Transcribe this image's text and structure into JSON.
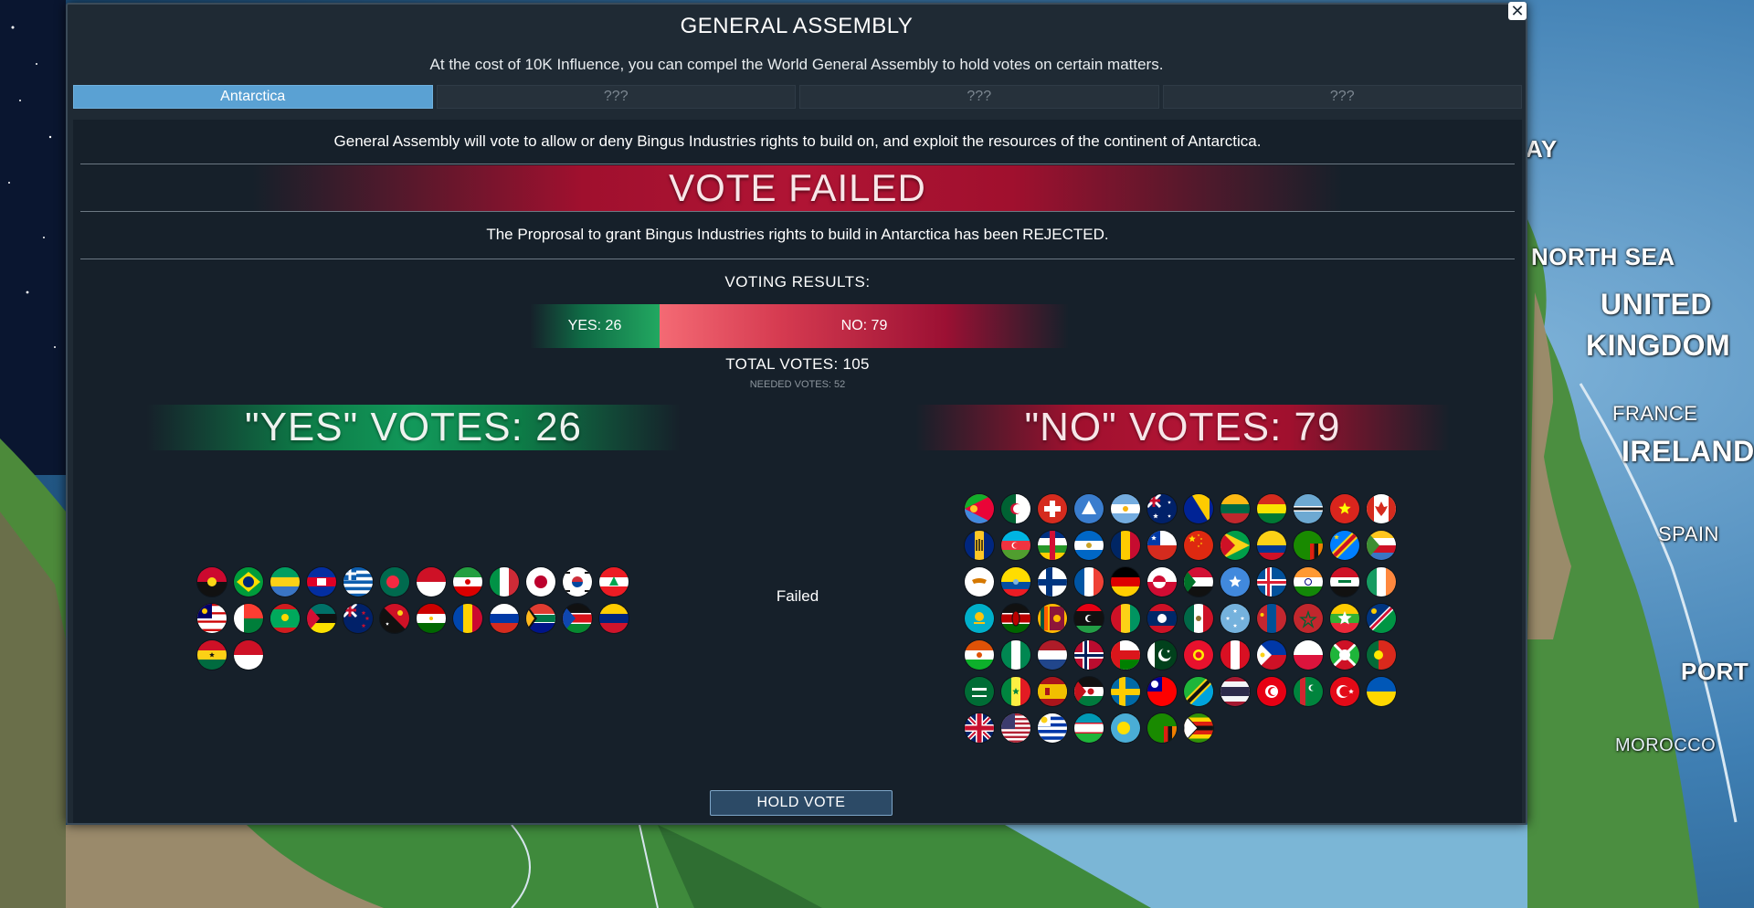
{
  "dialog": {
    "title": "GENERAL ASSEMBLY",
    "subtitle": "At the cost of 10K Influence, you can compel the World General Assembly to hold votes on certain matters.",
    "close_label": "✕",
    "tabs": [
      {
        "label": "Antarctica",
        "active": true
      },
      {
        "label": "???",
        "active": false
      },
      {
        "label": "???",
        "active": false
      },
      {
        "label": "???",
        "active": false
      }
    ]
  },
  "proposal": {
    "description": "General Assembly will vote to allow or deny Bingus Industries rights to build on, and exploit the resources of the continent of Antarctica.",
    "banner": "VOTE FAILED",
    "result_text": "The Proprosal to grant Bingus Industries rights to build in Antarctica has been REJECTED."
  },
  "results": {
    "heading": "VOTING RESULTS:",
    "yes_label": "YES: 26",
    "no_label": "NO: 79",
    "yes_count": 26,
    "no_count": 79,
    "total_votes": "TOTAL VOTES: 105",
    "needed_votes": "NEEDED VOTES: 52",
    "yes_header": "\"YES\" VOTES: 26",
    "no_header": "\"NO\" VOTES: 79",
    "status": "Failed",
    "colors": {
      "yes": "#22a861",
      "no": "#b01434",
      "accent": "#5aa1d3"
    }
  },
  "yes_flags": [
    "angola",
    "brazil",
    "gabon",
    "cambodia",
    "greece",
    "bangladesh",
    "indonesia",
    "iran",
    "italy",
    "japan",
    "south-korea",
    "lebanon",
    "malaysia",
    "madagascar",
    "mauritania",
    "mozambique",
    "new-zealand",
    "papua-new-guinea",
    "tajikistan",
    "moldova",
    "russia",
    "south-africa",
    "south-sudan",
    "venezuela",
    "ghana",
    "monaco"
  ],
  "no_flags": [
    "eritrea",
    "algeria",
    "switzerland",
    "antarctica",
    "argentina",
    "australia",
    "bosnia",
    "lithuania",
    "bolivia",
    "botswana",
    "vietnam",
    "canada",
    "barbados",
    "azerbaijan",
    "central-african-republic",
    "nicaragua",
    "chad",
    "chile",
    "china",
    "guyana",
    "colombia",
    "zambia",
    "dr-congo",
    "comoros",
    "cyprus",
    "ecuador",
    "finland",
    "france",
    "germany",
    "greenland",
    "sudan",
    "somalia",
    "iceland",
    "india",
    "iraq",
    "ireland",
    "kazakhstan",
    "kenya",
    "sri-lanka",
    "libya",
    "guinea",
    "laos",
    "mexico",
    "micronesia",
    "mongolia",
    "morocco",
    "myanmar",
    "namibia",
    "niger",
    "nigeria",
    "netherlands",
    "norway",
    "oman",
    "pakistan",
    "kyrgyzstan",
    "peru",
    "philippines",
    "poland",
    "burundi",
    "portugal",
    "saudi-arabia",
    "senegal",
    "spain",
    "sahrawi",
    "sweden",
    "taiwan",
    "tanzania",
    "thailand",
    "tunisia",
    "turkmenistan",
    "turkey",
    "ukraine",
    "united-kingdom",
    "united-states",
    "uruguay",
    "uzbekistan",
    "palau",
    "zambia",
    "zimbabwe"
  ],
  "actions": {
    "hold_vote": "HOLD VOTE"
  },
  "map_labels": [
    {
      "text": "NORTH SEA",
      "size": "md"
    },
    {
      "text": "UNITED",
      "size": "lg"
    },
    {
      "text": "KINGDOM",
      "size": "lg"
    },
    {
      "text": "FRANCE",
      "size": "sm"
    },
    {
      "text": "IRELAND",
      "size": "lg"
    },
    {
      "text": "SPAIN",
      "size": "sm"
    },
    {
      "text": "PORT",
      "size": "md"
    },
    {
      "text": "MOROCCO",
      "size": "xs"
    },
    {
      "text": "AY",
      "size": "md"
    }
  ]
}
